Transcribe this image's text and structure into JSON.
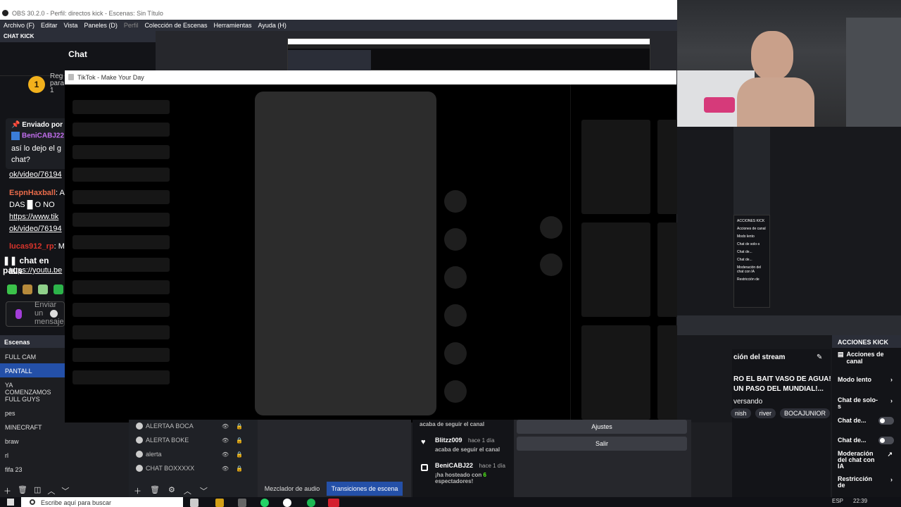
{
  "obs": {
    "title": "OBS 30.2.0 - Perfil: directos kick - Escenas: Sin Título",
    "menu": [
      {
        "label": "Archivo (F)",
        "dim": false
      },
      {
        "label": "Editar",
        "dim": false
      },
      {
        "label": "Vista",
        "dim": false
      },
      {
        "label": "Paneles (D)",
        "dim": false
      },
      {
        "label": "Perfil",
        "dim": true
      },
      {
        "label": "Colección de Escenas",
        "dim": false
      },
      {
        "label": "Herramientas",
        "dim": false
      },
      {
        "label": "Ayuda (H)",
        "dim": false
      }
    ]
  },
  "chat_dock": {
    "dock_title": "CHAT KICK",
    "header": "Chat",
    "badge": "1",
    "badge_text": [
      "Reg",
      "para",
      "1"
    ],
    "pinned_label": "Enviado por",
    "pinned_user": "BeniCABJ22",
    "pinned_text": [
      "así lo dejo el g",
      "chat?"
    ],
    "messages": [
      {
        "text": "ok/video/76194",
        "link": true
      },
      {
        "user": "EspnHaxball",
        "text": ": A"
      },
      {
        "text": "DAS █ O NO"
      },
      {
        "text": "https://www.tik",
        "link": true
      },
      {
        "text": "ok/video/76194",
        "link": true
      },
      {
        "user": "lucas912_rp",
        "text": ": M"
      },
      {
        "text": "https://youtu.be",
        "link": true
      }
    ],
    "paused": "chat en paus",
    "send_placeholder": [
      "Enviar",
      "un",
      "mensaje"
    ]
  },
  "tiktok": {
    "window_title": "TikTok - Make Your Day"
  },
  "scenes": {
    "title": "Escenas",
    "items": [
      "FULL CAM",
      "PANTALL",
      "YA COMENZAMOS",
      "FULL GUYS",
      "pes",
      "MINECRAFT",
      "braw",
      "rl",
      "fifa 23"
    ],
    "selected": 1
  },
  "sources": {
    "items": [
      "ALERTAA BOCA",
      "ALERTA BOKE",
      "alerta",
      "CHAT BOXXXXX"
    ]
  },
  "mixer_tabs": {
    "audio": "Mezclador de audio",
    "transitions": "Transiciones de escena"
  },
  "activity": [
    {
      "name": "",
      "time": "",
      "desc": "acaba de seguir el canal"
    },
    {
      "name": "Blitzz009",
      "time": "hace 1 día",
      "desc": "acaba de seguir el canal"
    },
    {
      "name": "BeniCABJ22",
      "time": "hace 1 día",
      "desc_pre": "¡ha hosteado con ",
      "count": "6",
      "desc_post": "espectadores!"
    }
  ],
  "controls": {
    "settings": "Ajustes",
    "exit": "Salir"
  },
  "stream_info": {
    "header": "ción del stream",
    "title": [
      "RO EL BAIT VASO DE AGUA!",
      "UN PASO DEL MUNDIAL!..."
    ],
    "category": "versando",
    "tags": [
      "nish",
      "river",
      "BOCAJUNIOR"
    ]
  },
  "kick_actions": {
    "title": "ACCIONES KICK",
    "channel_actions": "Acciones de canal",
    "items": [
      {
        "label": "Modo lento",
        "kind": "chevron"
      },
      {
        "label": "Chat de solo-s",
        "kind": "chevron"
      },
      {
        "label": "Chat de...",
        "kind": "toggle"
      },
      {
        "label": "Chat de...",
        "kind": "toggle"
      },
      {
        "label": "Moderación del chat con IA",
        "kind": "external"
      },
      {
        "label": "Restricción de",
        "kind": "chevron"
      }
    ]
  },
  "mini_kick": {
    "title": "ACCIONES KICK",
    "items": [
      "Acciones de canal",
      "Modo lento",
      "Chat de solo-s",
      "Chat de...",
      "Chat de...",
      "Moderación del chat con IA",
      "Restricción de"
    ]
  },
  "taskbar": {
    "search_placeholder": "Escribe aquí para buscar",
    "lang": "ESP",
    "time": "22:39"
  },
  "colors": {
    "accent": "#2450a8",
    "kick_green": "#53fc18",
    "badge": "#f2b11c"
  }
}
